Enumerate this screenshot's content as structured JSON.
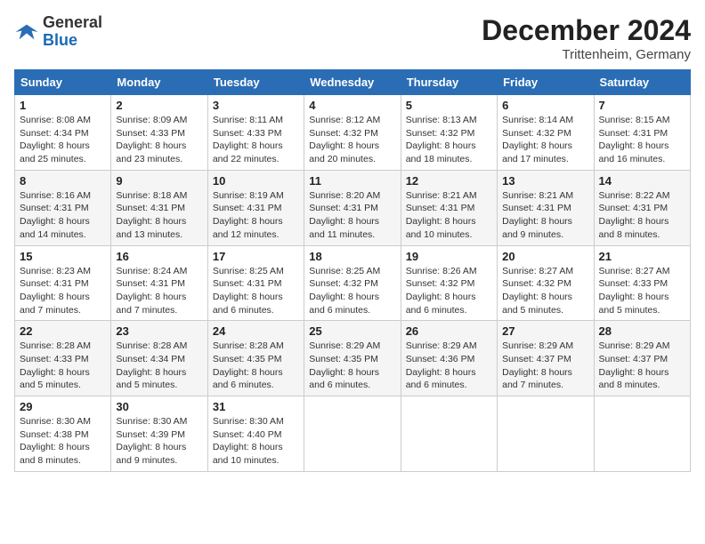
{
  "header": {
    "logo_general": "General",
    "logo_blue": "Blue",
    "month_year": "December 2024",
    "location": "Trittenheim, Germany"
  },
  "weekdays": [
    "Sunday",
    "Monday",
    "Tuesday",
    "Wednesday",
    "Thursday",
    "Friday",
    "Saturday"
  ],
  "weeks": [
    [
      {
        "day": "1",
        "sunrise": "8:08 AM",
        "sunset": "4:34 PM",
        "daylight": "8 hours and 25 minutes."
      },
      {
        "day": "2",
        "sunrise": "8:09 AM",
        "sunset": "4:33 PM",
        "daylight": "8 hours and 23 minutes."
      },
      {
        "day": "3",
        "sunrise": "8:11 AM",
        "sunset": "4:33 PM",
        "daylight": "8 hours and 22 minutes."
      },
      {
        "day": "4",
        "sunrise": "8:12 AM",
        "sunset": "4:32 PM",
        "daylight": "8 hours and 20 minutes."
      },
      {
        "day": "5",
        "sunrise": "8:13 AM",
        "sunset": "4:32 PM",
        "daylight": "8 hours and 18 minutes."
      },
      {
        "day": "6",
        "sunrise": "8:14 AM",
        "sunset": "4:32 PM",
        "daylight": "8 hours and 17 minutes."
      },
      {
        "day": "7",
        "sunrise": "8:15 AM",
        "sunset": "4:31 PM",
        "daylight": "8 hours and 16 minutes."
      }
    ],
    [
      {
        "day": "8",
        "sunrise": "8:16 AM",
        "sunset": "4:31 PM",
        "daylight": "8 hours and 14 minutes."
      },
      {
        "day": "9",
        "sunrise": "8:18 AM",
        "sunset": "4:31 PM",
        "daylight": "8 hours and 13 minutes."
      },
      {
        "day": "10",
        "sunrise": "8:19 AM",
        "sunset": "4:31 PM",
        "daylight": "8 hours and 12 minutes."
      },
      {
        "day": "11",
        "sunrise": "8:20 AM",
        "sunset": "4:31 PM",
        "daylight": "8 hours and 11 minutes."
      },
      {
        "day": "12",
        "sunrise": "8:21 AM",
        "sunset": "4:31 PM",
        "daylight": "8 hours and 10 minutes."
      },
      {
        "day": "13",
        "sunrise": "8:21 AM",
        "sunset": "4:31 PM",
        "daylight": "8 hours and 9 minutes."
      },
      {
        "day": "14",
        "sunrise": "8:22 AM",
        "sunset": "4:31 PM",
        "daylight": "8 hours and 8 minutes."
      }
    ],
    [
      {
        "day": "15",
        "sunrise": "8:23 AM",
        "sunset": "4:31 PM",
        "daylight": "8 hours and 7 minutes."
      },
      {
        "day": "16",
        "sunrise": "8:24 AM",
        "sunset": "4:31 PM",
        "daylight": "8 hours and 7 minutes."
      },
      {
        "day": "17",
        "sunrise": "8:25 AM",
        "sunset": "4:31 PM",
        "daylight": "8 hours and 6 minutes."
      },
      {
        "day": "18",
        "sunrise": "8:25 AM",
        "sunset": "4:32 PM",
        "daylight": "8 hours and 6 minutes."
      },
      {
        "day": "19",
        "sunrise": "8:26 AM",
        "sunset": "4:32 PM",
        "daylight": "8 hours and 6 minutes."
      },
      {
        "day": "20",
        "sunrise": "8:27 AM",
        "sunset": "4:32 PM",
        "daylight": "8 hours and 5 minutes."
      },
      {
        "day": "21",
        "sunrise": "8:27 AM",
        "sunset": "4:33 PM",
        "daylight": "8 hours and 5 minutes."
      }
    ],
    [
      {
        "day": "22",
        "sunrise": "8:28 AM",
        "sunset": "4:33 PM",
        "daylight": "8 hours and 5 minutes."
      },
      {
        "day": "23",
        "sunrise": "8:28 AM",
        "sunset": "4:34 PM",
        "daylight": "8 hours and 5 minutes."
      },
      {
        "day": "24",
        "sunrise": "8:28 AM",
        "sunset": "4:35 PM",
        "daylight": "8 hours and 6 minutes."
      },
      {
        "day": "25",
        "sunrise": "8:29 AM",
        "sunset": "4:35 PM",
        "daylight": "8 hours and 6 minutes."
      },
      {
        "day": "26",
        "sunrise": "8:29 AM",
        "sunset": "4:36 PM",
        "daylight": "8 hours and 6 minutes."
      },
      {
        "day": "27",
        "sunrise": "8:29 AM",
        "sunset": "4:37 PM",
        "daylight": "8 hours and 7 minutes."
      },
      {
        "day": "28",
        "sunrise": "8:29 AM",
        "sunset": "4:37 PM",
        "daylight": "8 hours and 8 minutes."
      }
    ],
    [
      {
        "day": "29",
        "sunrise": "8:30 AM",
        "sunset": "4:38 PM",
        "daylight": "8 hours and 8 minutes."
      },
      {
        "day": "30",
        "sunrise": "8:30 AM",
        "sunset": "4:39 PM",
        "daylight": "8 hours and 9 minutes."
      },
      {
        "day": "31",
        "sunrise": "8:30 AM",
        "sunset": "4:40 PM",
        "daylight": "8 hours and 10 minutes."
      },
      null,
      null,
      null,
      null
    ]
  ],
  "labels": {
    "sunrise": "Sunrise: ",
    "sunset": "Sunset: ",
    "daylight": "Daylight: "
  }
}
